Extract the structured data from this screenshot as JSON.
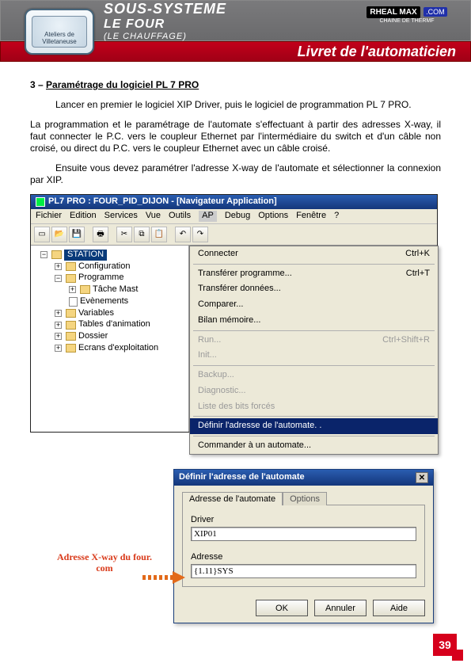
{
  "header": {
    "emblem_text": "Ateliers de Villetaneuse",
    "line1": "SOUS-SYSTEME",
    "line2": "LE FOUR",
    "sub": "(LE CHAUFFAGE)",
    "brand": "RHEAL MAX",
    "com": ".COM",
    "tag": "CHAINE DE THERMF",
    "redtitle": "Livret de l'automaticien"
  },
  "section": {
    "num": "3 – ",
    "title": "Paramétrage du logiciel PL 7 PRO"
  },
  "para1": "Lancer en premier le logiciel XIP Driver, puis le logiciel de programmation PL 7 PRO.",
  "para2": "La programmation et le paramétrage de l'automate s'effectuant à partir des adresses X-way, il faut connecter le P.C. vers le coupleur Ethernet par l'intermédiaire du switch et d'un câble non croisé, ou direct du P.C. vers le coupleur Ethernet avec un câble croisé.",
  "para3": "Ensuite vous devez paramétrer l'adresse X-way de l'automate et sélectionner la connexion par XIP.",
  "app": {
    "title": "PL7 PRO : FOUR_PID_DIJON - [Navigateur Application]",
    "menus": [
      "Fichier",
      "Edition",
      "Services",
      "Vue",
      "Outils",
      "AP",
      "Debug",
      "Options",
      "Fenêtre",
      "?"
    ],
    "tree": {
      "root": "STATION",
      "n1": "Configuration",
      "n2": "Programme",
      "n3": "Tâche Mast",
      "n4": "Evènements",
      "n5": "Variables",
      "n6": "Tables d'animation",
      "n7": "Dossier",
      "n8": "Ecrans d'exploitation"
    },
    "menu": {
      "m1": "Connecter",
      "m1s": "Ctrl+K",
      "m2": "Transférer programme...",
      "m2s": "Ctrl+T",
      "m3": "Transférer données...",
      "m4": "Comparer...",
      "m5": "Bilan mémoire...",
      "m6": "Run...",
      "m6s": "Ctrl+Shift+R",
      "m7": "Init...",
      "m8": "Backup...",
      "m9": "Diagnostic...",
      "m10": "Liste des bits forcés",
      "m11": "Définir l'adresse de l'automate. .",
      "m12": "Commander à un automate..."
    }
  },
  "dialog": {
    "title": "Définir l'adresse de l'automate",
    "tab1": "Adresse de l'automate",
    "tab2": "Options",
    "driver_label": "Driver",
    "driver_value": "XIP01",
    "addr_label": "Adresse",
    "addr_value": "{1.11}SYS",
    "ok": "OK",
    "cancel": "Annuler",
    "help": "Aide"
  },
  "annotation": "Adresse X-way du four. com",
  "pagenum": "39"
}
